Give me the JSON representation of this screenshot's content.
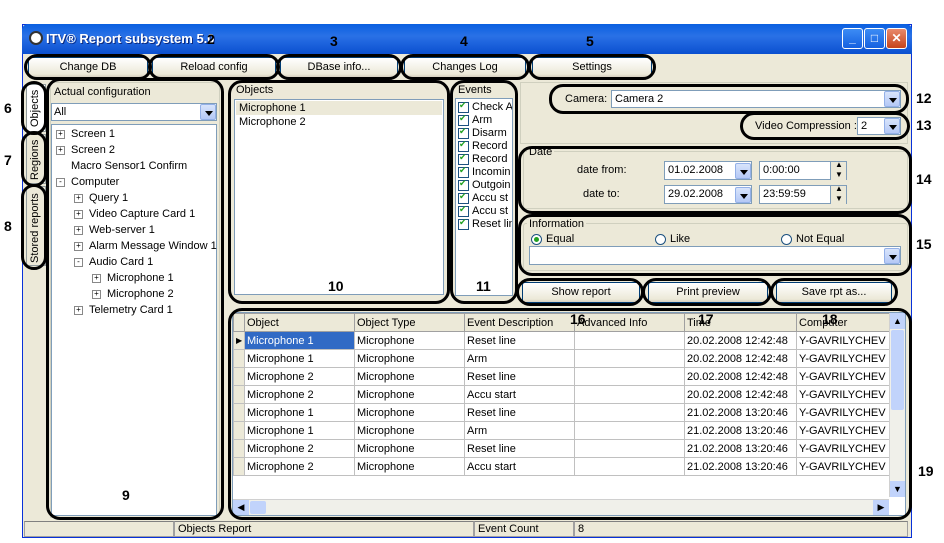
{
  "window": {
    "title": "ITV® Report subsystem 5.0"
  },
  "toolbar": {
    "change_db": "Change DB",
    "reload_config": "Reload config",
    "dbase_info": "DBase info...",
    "changes_log": "Changes Log",
    "settings": "Settings"
  },
  "side_tabs": {
    "objects": "Objects",
    "regions": "Regions",
    "stored_reports": "Stored reports"
  },
  "config": {
    "title": "Actual configuration",
    "filter_value": "All",
    "tree": [
      {
        "label": "Screen 1",
        "expander": "+"
      },
      {
        "label": "Screen 2",
        "expander": "+"
      },
      {
        "label": "Macro Sensor1 Confirm",
        "expander": ""
      },
      {
        "label": "Computer",
        "expander": "-"
      },
      {
        "label": "Query 1",
        "expander": "+"
      },
      {
        "label": "Video Capture Card 1",
        "expander": "+"
      },
      {
        "label": "Web-server 1",
        "expander": "+"
      },
      {
        "label": "Alarm Message Window 1",
        "expander": "+"
      },
      {
        "label": "Audio Card 1",
        "expander": "-"
      },
      {
        "label": "Microphone 1",
        "expander": "+"
      },
      {
        "label": "Microphone 2",
        "expander": "+"
      },
      {
        "label": "Telemetry Card 1",
        "expander": "+"
      }
    ]
  },
  "objects": {
    "title": "Objects",
    "items": [
      "Microphone 1",
      "Microphone 2"
    ]
  },
  "events": {
    "title": "Events",
    "items": [
      "Check A",
      "Arm",
      "Disarm",
      "Record",
      "Record",
      "Incomin",
      "Outgoin",
      "Accu st",
      "Accu st",
      "Reset lin"
    ]
  },
  "camera": {
    "label": "Camera:",
    "value": "Camera 2"
  },
  "video_compression": {
    "label": "Video Compression :",
    "value": "2"
  },
  "date": {
    "group": "Date",
    "from_label": "date from:",
    "from_date": "01.02.2008",
    "from_time": "0:00:00",
    "to_label": "date to:",
    "to_date": "29.02.2008",
    "to_time": "23:59:59"
  },
  "information": {
    "group": "Information",
    "equal": "Equal",
    "like": "Like",
    "not_equal": "Not Equal",
    "value": ""
  },
  "actions": {
    "show_report": "Show report",
    "print_preview": "Print preview",
    "save_rpt": "Save rpt as..."
  },
  "grid": {
    "columns": [
      "Object",
      "Object Type",
      "Event Description",
      "Advanced Info",
      "Time",
      "Computer"
    ],
    "rows": [
      [
        "Microphone 1",
        "Microphone",
        "Reset line",
        "",
        "20.02.2008 12:42:48",
        "Y-GAVRILYCHEV"
      ],
      [
        "Microphone 1",
        "Microphone",
        "Arm",
        "",
        "20.02.2008 12:42:48",
        "Y-GAVRILYCHEV"
      ],
      [
        "Microphone 2",
        "Microphone",
        "Reset line",
        "",
        "20.02.2008 12:42:48",
        "Y-GAVRILYCHEV"
      ],
      [
        "Microphone 2",
        "Microphone",
        "Accu start",
        "",
        "20.02.2008 12:42:48",
        "Y-GAVRILYCHEV"
      ],
      [
        "Microphone 1",
        "Microphone",
        "Reset line",
        "",
        "21.02.2008 13:20:46",
        "Y-GAVRILYCHEV"
      ],
      [
        "Microphone 1",
        "Microphone",
        "Arm",
        "",
        "21.02.2008 13:20:46",
        "Y-GAVRILYCHEV"
      ],
      [
        "Microphone 2",
        "Microphone",
        "Reset line",
        "",
        "21.02.2008 13:20:46",
        "Y-GAVRILYCHEV"
      ],
      [
        "Microphone 2",
        "Microphone",
        "Accu start",
        "",
        "21.02.2008 13:20:46",
        "Y-GAVRILYCHEV"
      ]
    ]
  },
  "status": {
    "report": "Objects Report",
    "event_count_label": "Event Count",
    "event_count": "8"
  },
  "callouts": [
    "2",
    "3",
    "4",
    "5",
    "6",
    "7",
    "8",
    "9",
    "10",
    "11",
    "12",
    "13",
    "14",
    "15",
    "16",
    "17",
    "18",
    "19"
  ]
}
